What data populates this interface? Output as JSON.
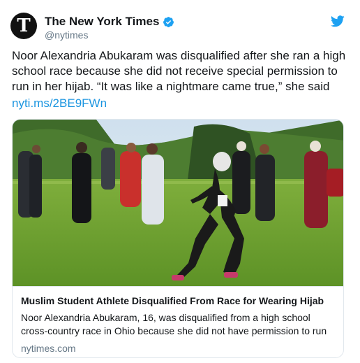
{
  "author": {
    "display_name": "The New York Times",
    "handle": "@nytimes",
    "avatar_letter": "T",
    "verified_icon": "verified-badge-icon",
    "verified_color": "#1da1f2"
  },
  "platform_icon": "twitter-bird-icon",
  "tweet": {
    "text": "Noor Alexandria Abukaram was disqualified after she ran a high school race because she did not receive special permission to run in her hijab. “It was like a nightmare came true,” she said",
    "link": "nyti.ms/2BE9FWn"
  },
  "card": {
    "image_description_icon": "runner-photo",
    "title": "Muslim Student Athlete Disqualified From Race for Wearing Hijab",
    "description": "Noor Alexandria Abukaram, 16, was disqualified from a high school cross-country race in Ohio because she did not have permission to run",
    "domain": "nytimes.com"
  },
  "colors": {
    "link": "#1b95e0",
    "secondary_text": "#657786",
    "border": "#e1e8ed"
  }
}
